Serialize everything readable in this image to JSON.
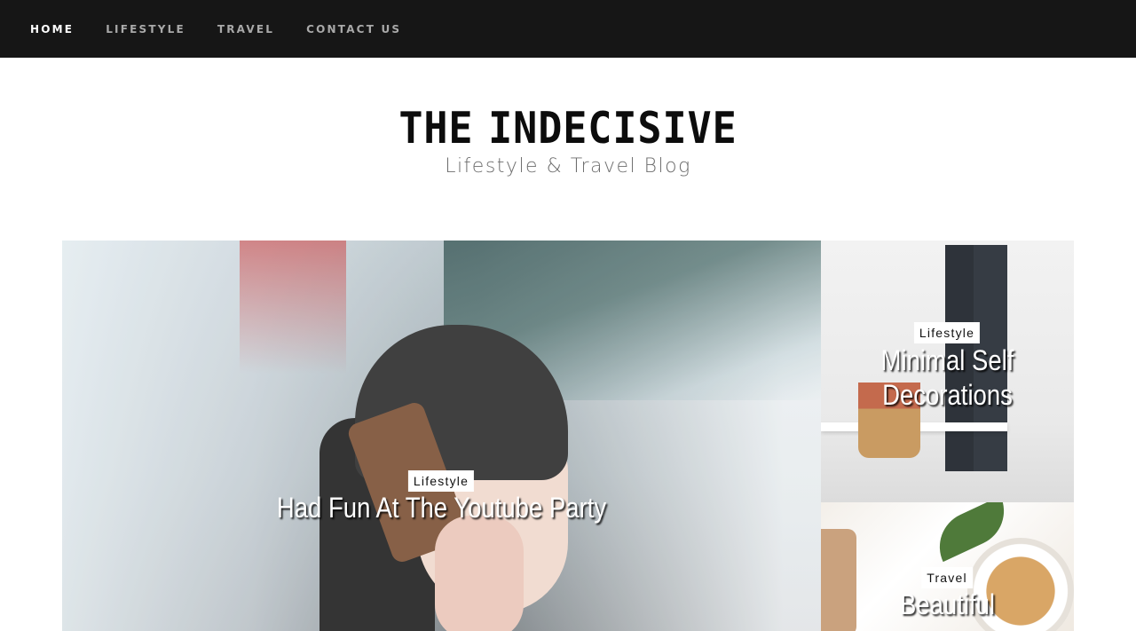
{
  "nav": {
    "items": [
      {
        "label": "HOME",
        "active": true
      },
      {
        "label": "LIFESTYLE",
        "active": false
      },
      {
        "label": "TRAVEL",
        "active": false
      },
      {
        "label": "CONTACT US",
        "active": false
      }
    ]
  },
  "brand": {
    "title_word1": "THE",
    "title_word2": "INDECISIVE",
    "tagline": "Lifestyle & Travel Blog"
  },
  "featured": {
    "main": {
      "category": "Lifestyle",
      "title": "Had Fun At The Youtube Party"
    },
    "side_top": {
      "category": "Lifestyle",
      "title": "Minimal Self Decorations"
    },
    "side_bottom": {
      "category": "Travel",
      "title": "Beautiful"
    }
  },
  "colors": {
    "nav_bg": "#161616",
    "nav_active": "#ffffff",
    "nav_inactive": "#a9a9a9"
  }
}
